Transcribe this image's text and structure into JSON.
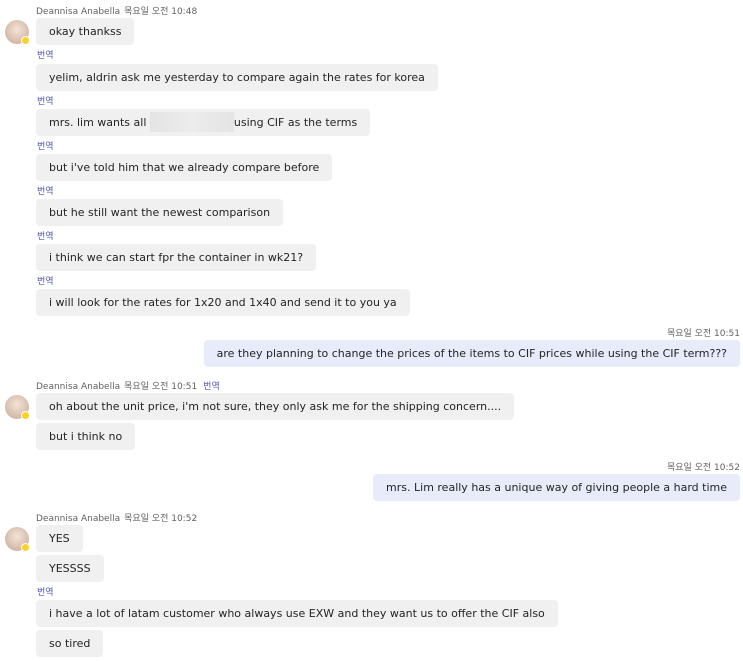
{
  "sender_name": "Deannisa Anabella",
  "translate_label": "번역",
  "groups": [
    {
      "time": "목요일 오전 10:48"
    },
    {
      "time": "목요일 오전 10:51"
    },
    {
      "time": "목요일 오전 10:52"
    }
  ],
  "my_times": [
    "목요일 오전 10:51",
    "목요일 오전 10:52"
  ],
  "messages": {
    "m1": "okay thankss",
    "m2": "yelim, aldrin ask me yesterday to compare again the rates for korea",
    "m3a": "mrs. lim wants all",
    "m3b": "using CIF as the terms",
    "m4": "but i've told him that we already compare before",
    "m5": "but he still want the newest comparison",
    "m6": "i think we can start fpr the container in wk21?",
    "m7": "i will look for the rates for 1x20 and 1x40 and send it to you ya",
    "me1": "are they planning to change the prices of the items to CIF prices while using the CIF term???",
    "m8": "oh about the unit price, i'm not sure, they only ask me for the shipping concern....",
    "m9": "but i think no",
    "me2": "mrs. Lim really has a unique way of giving people a hard time",
    "m10": "YES",
    "m11": "YESSSS",
    "m12": "i have a lot of latam customer who always use EXW and they want us to offer the CIF also",
    "m13": "so tired"
  }
}
